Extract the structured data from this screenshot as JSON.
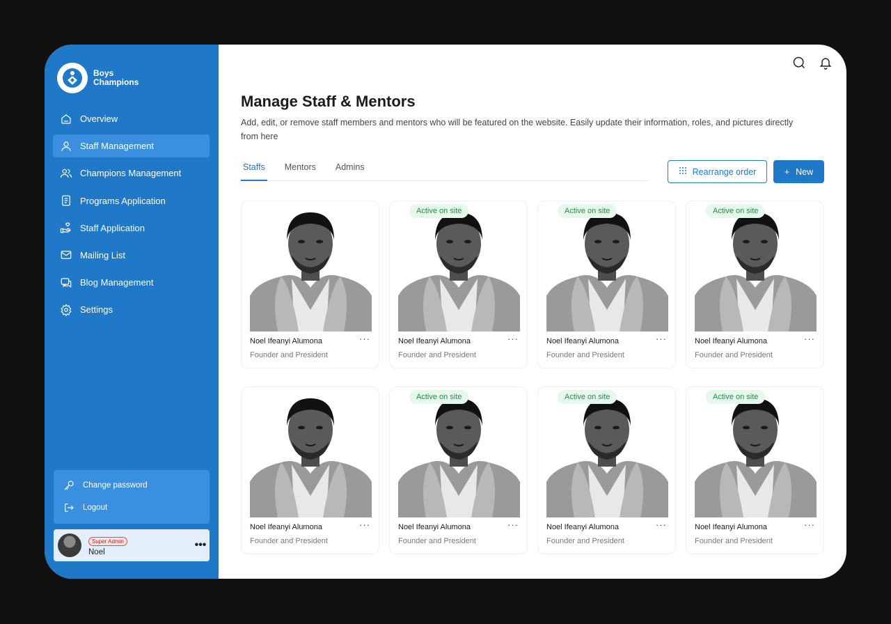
{
  "brand": {
    "line1": "Boys",
    "line2": "Champions"
  },
  "sidebar": {
    "items": [
      {
        "label": "Overview",
        "icon": "home-icon"
      },
      {
        "label": "Staff Management",
        "icon": "user-icon",
        "active": true
      },
      {
        "label": "Champions Management",
        "icon": "users-icon"
      },
      {
        "label": "Programs Application",
        "icon": "document-icon"
      },
      {
        "label": "Staff Application",
        "icon": "hand-heart-icon"
      },
      {
        "label": "Mailing List",
        "icon": "mail-icon"
      },
      {
        "label": "Blog Management",
        "icon": "chat-icon"
      },
      {
        "label": "Settings",
        "icon": "gear-icon"
      }
    ],
    "account": {
      "change_password": "Change password",
      "logout": "Logout"
    },
    "user": {
      "role": "Super Admin",
      "name": "Noel",
      "more": "•••"
    }
  },
  "header": {
    "title": "Manage Staff & Mentors",
    "description": "Add, edit, or remove staff members and mentors who will be featured on the website. Easily update their information, roles, and pictures directly from here"
  },
  "tabs": [
    "Staffs",
    "Mentors",
    "Admins"
  ],
  "actions": {
    "rearrange": "Rearrange order",
    "new": "New",
    "new_icon": "+"
  },
  "cards": [
    {
      "name": "Noel Ifeanyi Alumona",
      "role": "Founder and President",
      "badge": ""
    },
    {
      "name": "Noel Ifeanyi Alumona",
      "role": "Founder and President",
      "badge": "Active on site"
    },
    {
      "name": "Noel Ifeanyi Alumona",
      "role": "Founder and President",
      "badge": "Active on site"
    },
    {
      "name": "Noel Ifeanyi Alumona",
      "role": "Founder and President",
      "badge": "Active on site"
    },
    {
      "name": "Noel Ifeanyi Alumona",
      "role": "Founder and President",
      "badge": ""
    },
    {
      "name": "Noel Ifeanyi Alumona",
      "role": "Founder and President",
      "badge": "Active on site"
    },
    {
      "name": "Noel Ifeanyi Alumona",
      "role": "Founder and President",
      "badge": "Active on site"
    },
    {
      "name": "Noel Ifeanyi Alumona",
      "role": "Founder and President",
      "badge": "Active on site"
    }
  ],
  "card_more": "···",
  "colors": {
    "primary": "#1f78c8",
    "active_bg": "#3a8fde",
    "badge_bg": "#e6f7ec",
    "badge_text": "#1f8d48"
  }
}
